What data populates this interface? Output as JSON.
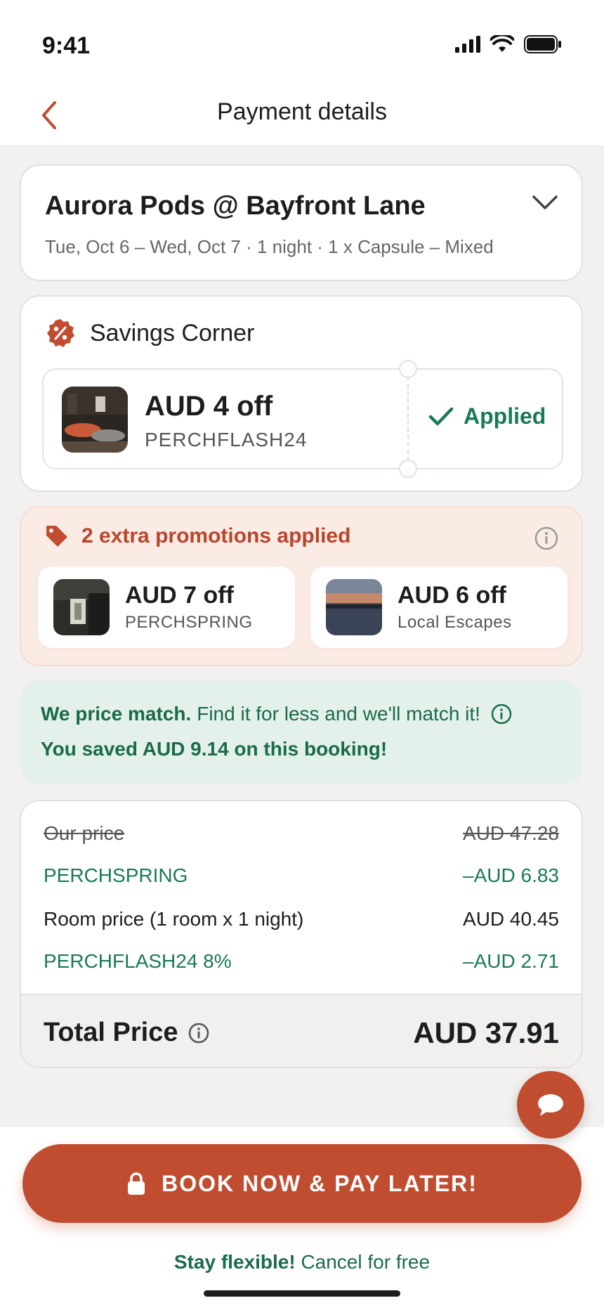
{
  "status_bar": {
    "time": "9:41"
  },
  "nav": {
    "title": "Payment details"
  },
  "hotel": {
    "name": "Aurora Pods @ Bayfront Lane",
    "details": "Tue, Oct 6 – Wed, Oct 7 · 1 night · 1 x Capsule – Mixed"
  },
  "savings": {
    "title": "Savings Corner",
    "coupon": {
      "title": "AUD 4 off",
      "code": "PERCHFLASH24",
      "status": "Applied"
    }
  },
  "promotions": {
    "title": "2 extra promotions applied",
    "items": [
      {
        "title": "AUD 7 off",
        "subtitle": "PERCHSPRING"
      },
      {
        "title": "AUD 6 off",
        "subtitle": "Local Escapes"
      }
    ]
  },
  "price_match": {
    "bold": "We price match.",
    "text": "Find it for less and we'll match it!",
    "saved": "You saved AUD 9.14 on this booking!"
  },
  "price_breakdown": {
    "rows": [
      {
        "label": "Our price",
        "value": "AUD 47.28"
      },
      {
        "label": "PERCHSPRING",
        "value": "–AUD 6.83"
      },
      {
        "label": "Room price (1 room x 1 night)",
        "value": "AUD 40.45"
      },
      {
        "label": "PERCHFLASH24 8%",
        "value": "–AUD 2.71"
      }
    ],
    "total_label": "Total Price",
    "total_value": "AUD 37.91"
  },
  "cta": {
    "book_label": "BOOK NOW & PAY LATER!",
    "flex_bold": "Stay flexible!",
    "flex_text": "Cancel for free"
  },
  "colors": {
    "accent": "#c04d30",
    "success": "#1a7a55",
    "promo_bg": "#fbebe5",
    "match_bg": "#e3f1ea"
  }
}
